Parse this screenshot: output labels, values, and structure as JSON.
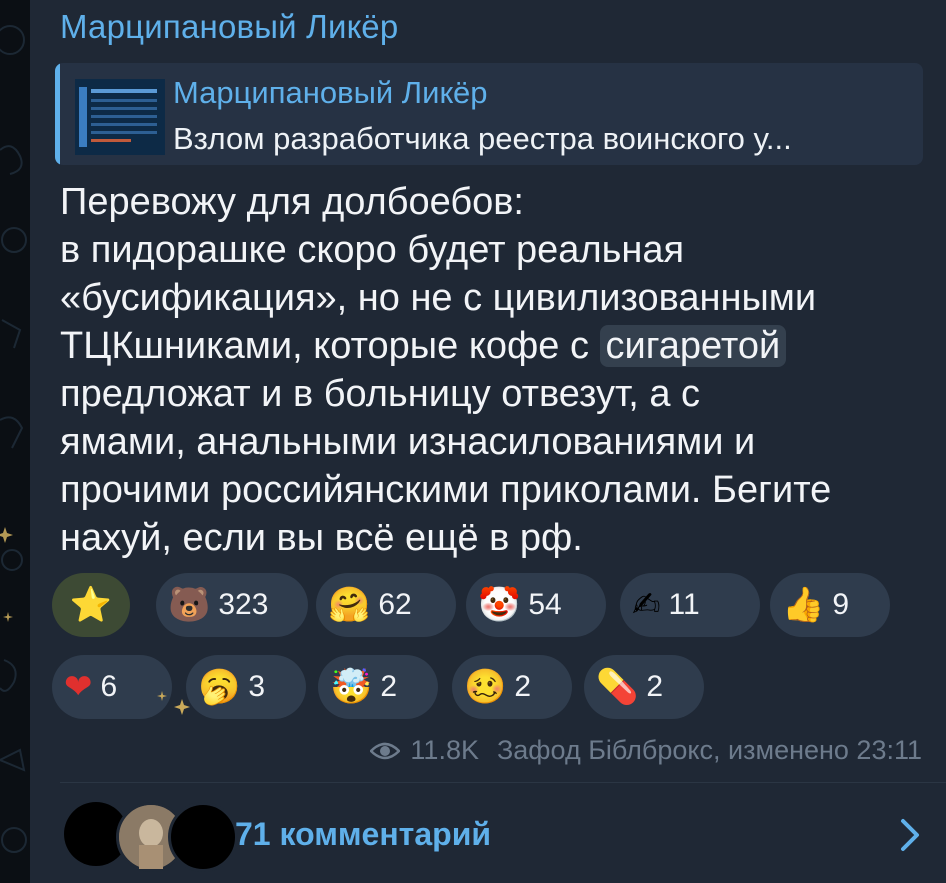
{
  "channel": {
    "name": "Марципановый Ликёр"
  },
  "reply": {
    "title": "Марципановый Ликёр",
    "text": "Взлом разработчика реестра воинского у..."
  },
  "post": {
    "lines": [
      "Перевожу для долбоебов:",
      "в пидорашке скоро будет реальная",
      "«бусификация», но не с цивилизованными",
      "ТЦКшниками, которые кофе с ",
      "предложат и в больницу отвезут, а с",
      "ямами, анальными изнасилованиями и",
      "прочими российянскими приколами. Бегите",
      "нахуй, если вы всё ещё в рф."
    ],
    "spoiler": "сигаретой"
  },
  "reactions": [
    {
      "emoji": "⭐",
      "count": "",
      "icon": "star-icon"
    },
    {
      "emoji": "🐻",
      "count": "323",
      "icon": "bear-icon"
    },
    {
      "emoji": "🤗",
      "count": "62",
      "icon": "hugging-face-icon"
    },
    {
      "emoji": "🤡",
      "count": "54",
      "icon": "clown-icon"
    },
    {
      "emoji": "✍",
      "count": "11",
      "icon": "writing-hand-icon"
    },
    {
      "emoji": "👍",
      "count": "9",
      "icon": "thumbs-up-icon"
    },
    {
      "emoji": "❤",
      "count": "6",
      "icon": "heart-icon"
    },
    {
      "emoji": "🥱",
      "count": "3",
      "icon": "yawning-face-icon"
    },
    {
      "emoji": "🤯",
      "count": "2",
      "icon": "exploding-head-icon"
    },
    {
      "emoji": "🥴",
      "count": "2",
      "icon": "woozy-face-icon"
    },
    {
      "emoji": "💊",
      "count": "2",
      "icon": "pill-icon"
    }
  ],
  "meta": {
    "views": "11.8K",
    "author": "Зафод Біблброкс, изменено 23:11"
  },
  "comments": {
    "label": "71 комментарий"
  },
  "colors": {
    "accent": "#5fb0ea",
    "bubble": "#1f2835",
    "chip": "#2f3c4d"
  }
}
